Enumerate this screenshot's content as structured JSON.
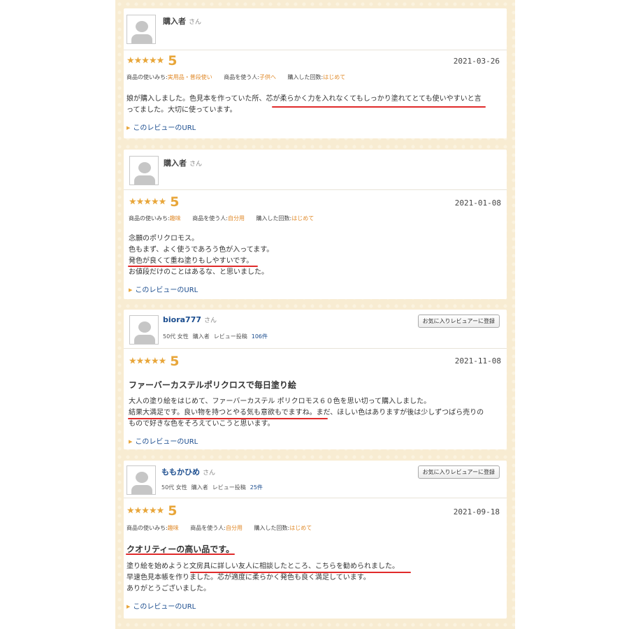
{
  "common": {
    "san": "さん",
    "link_text": "このレビューのURL",
    "fav_button": "お気に入りレビュアーに登録",
    "label_usage": "商品の使いみち:",
    "label_user": "商品を使う人:",
    "label_count": "購入した回数:",
    "label_posts": "レビュー投稿",
    "label_buyer": "購入者"
  },
  "reviews": [
    {
      "name": "購入者",
      "stars": "★★★★★",
      "score": "5",
      "date": "2021-03-26",
      "usage": "実用品・普段使い",
      "user": "子供へ",
      "count": "はじめて",
      "lines": [
        [
          "娘が購入しました。色見本を作っていた所、",
          "芯が柔らかく力を入れなくてもしっかり塗れてとても使いやすい",
          "と言"
        ],
        [
          "ってました。大切に使っています。"
        ]
      ]
    },
    {
      "name": "購入者",
      "stars": "★★★★★",
      "score": "5",
      "date": "2021-01-08",
      "usage": "趣味",
      "user": "自分用",
      "count": "はじめて",
      "lines": [
        [
          "念願のポリクロモス。"
        ],
        [
          "色もまず、よく使うであろう色が入ってます。"
        ],
        [
          "",
          "発色が良くて重ね塗りもしやすいです。",
          ""
        ],
        [
          "お値段だけのことはあるな、と思いました。"
        ]
      ]
    },
    {
      "name": "biora777",
      "age": "50代 女性",
      "buyer": "購入者",
      "posts": "106件",
      "stars": "★★★★★",
      "score": "5",
      "date": "2021-11-08",
      "title": "ファーバーカステルポリクロスで毎日塗り絵",
      "lines": [
        [
          "大人の塗り絵をはじめて、ファーバーカステル ポリクロモス６０色を思い切って購入しました。"
        ],
        [
          "",
          "結果大満足です。良い物を持つとやる気も意欲もでますね。",
          "まだ、ほしい色はありますが後は少しずつばら売りの"
        ],
        [
          "もので好きな色をそろえていこうと思います。"
        ]
      ]
    },
    {
      "name": "ももかひめ",
      "age": "50代 女性",
      "buyer": "購入者",
      "posts": "25件",
      "stars": "★★★★★",
      "score": "5",
      "date": "2021-09-18",
      "usage": "趣味",
      "user": "自分用",
      "count": "はじめて",
      "title": "クオリティーの高い品です。",
      "lines": [
        [
          "塗り絵を始めようと",
          "文房具に詳しい友人に相談したところ、こちらを勧められました。",
          ""
        ],
        [
          "早速色見本帳を作りました。芯が適度に柔らかく発色も良く満足しています。"
        ],
        [
          "ありがとうございました。"
        ]
      ]
    }
  ]
}
